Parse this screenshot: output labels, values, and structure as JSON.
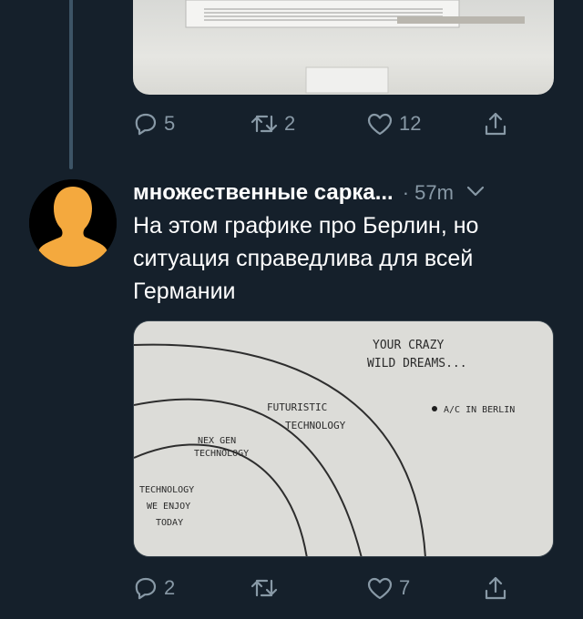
{
  "tweet_prev": {
    "replies": "5",
    "retweets": "2",
    "likes": "12"
  },
  "tweet": {
    "author": "множественные сарка...",
    "time": "· 57m",
    "text_lines": [
      "На этом графике про Берлин, но",
      "ситуация справедлива для всей",
      "Германии"
    ],
    "replies": "2",
    "retweets": "",
    "likes": "7",
    "image": {
      "labels": {
        "dreams_1": "YOUR CRAZY",
        "dreams_2": "WILD DREAMS...",
        "futuristic_1": "FUTURISTIC",
        "futuristic_2": "TECHNOLOGY",
        "nexgen_1": "NEX GEN",
        "nexgen_2": "TECHNOLOGY",
        "today_1": "TECHNOLOGY",
        "today_2": "WE ENJOY",
        "today_3": "TODAY",
        "point": "A/C IN BERLIN"
      }
    }
  },
  "colors": {
    "background": "#15202b",
    "muted": "#8899a6",
    "avatar": "#f4a93e"
  },
  "icons": [
    "reply-icon",
    "retweet-icon",
    "like-icon",
    "share-icon",
    "chevron-down-icon"
  ]
}
